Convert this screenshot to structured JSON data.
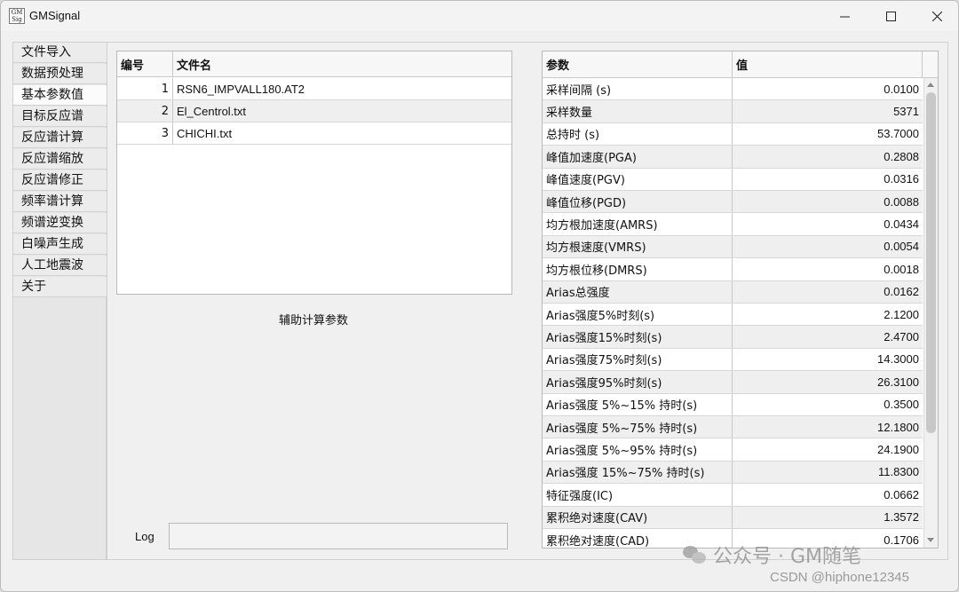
{
  "window": {
    "title": "GMSignal",
    "icon_text": "GM\nSignal",
    "controls": {
      "minimize": "—",
      "maximize": "☐",
      "close": "✕"
    }
  },
  "nav": {
    "items": [
      {
        "label": "文件导入"
      },
      {
        "label": "数据预处理"
      },
      {
        "label": "基本参数值"
      },
      {
        "label": "目标反应谱"
      },
      {
        "label": "反应谱计算"
      },
      {
        "label": "反应谱缩放"
      },
      {
        "label": "反应谱修正"
      },
      {
        "label": "频率谱计算"
      },
      {
        "label": "频谱逆变换"
      },
      {
        "label": "白噪声生成"
      },
      {
        "label": "人工地震波"
      },
      {
        "label": "关于"
      }
    ],
    "active_index": 2
  },
  "file_table": {
    "headers": [
      "编号",
      "文件名"
    ],
    "rows": [
      [
        "1",
        "RSN6_IMPVALL180.AT2"
      ],
      [
        "2",
        "El_Centrol.txt"
      ],
      [
        "3",
        "CHICHI.txt"
      ]
    ]
  },
  "aux_label": "辅助计算参数",
  "log": {
    "label": "Log",
    "value": ""
  },
  "param_table": {
    "headers": [
      "参数",
      "值"
    ],
    "rows": [
      [
        "采样间隔 (s)",
        "0.0100"
      ],
      [
        "采样数量",
        "5371"
      ],
      [
        "总持时 (s)",
        "53.7000"
      ],
      [
        "峰值加速度(PGA)",
        "0.2808"
      ],
      [
        "峰值速度(PGV)",
        "0.0316"
      ],
      [
        "峰值位移(PGD)",
        "0.0088"
      ],
      [
        "均方根加速度(AMRS)",
        "0.0434"
      ],
      [
        "均方根速度(VMRS)",
        "0.0054"
      ],
      [
        "均方根位移(DMRS)",
        "0.0018"
      ],
      [
        "Arias总强度",
        "0.0162"
      ],
      [
        "Arias强度5%时刻(s)",
        "2.1200"
      ],
      [
        "Arias强度15%时刻(s)",
        "2.4700"
      ],
      [
        "Arias强度75%时刻(s)",
        "14.3000"
      ],
      [
        "Arias强度95%时刻(s)",
        "26.3100"
      ],
      [
        "Arias强度 5%~15% 持时(s)",
        "0.3500"
      ],
      [
        "Arias强度 5%~75% 持时(s)",
        "12.1800"
      ],
      [
        "Arias强度 5%~95% 持时(s)",
        "24.1900"
      ],
      [
        "Arias强度 15%~75% 持时(s)",
        "11.8300"
      ],
      [
        "特征强度(IC)",
        "0.0662"
      ],
      [
        "累积绝对速度(CAV)",
        "1.3572"
      ],
      [
        "累积绝对速度(CAD)",
        "0.1706"
      ]
    ]
  },
  "watermark": {
    "text": "公众号 · GM随笔",
    "csdn": "CSDN @hiphone12345"
  }
}
